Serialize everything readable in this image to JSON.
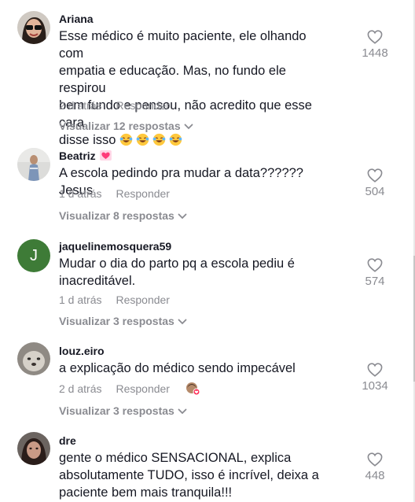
{
  "comments": [
    {
      "username": "Ariana",
      "text_lines": [
        "Esse médico é muito paciente, ele olhando com",
        "empatia e educação. Mas, no fundo ele respirou",
        "bem fundo e pensou, não acredito que esse cara",
        "disse isso"
      ],
      "time": "2 d atrás",
      "reply_label": "Responder",
      "view_replies": "Visualizar 12 respostas",
      "likes": "1448"
    },
    {
      "username": "Beatriz",
      "text_lines": [
        "A escola pedindo pra mudar a data?????? Jesus"
      ],
      "time": "1 d atrás",
      "reply_label": "Responder",
      "view_replies": "Visualizar 8 respostas",
      "likes": "504"
    },
    {
      "username": "jaquelinemosquera59",
      "avatar_letter": "J",
      "text_lines": [
        "Mudar o dia do parto pq a escola pediu é",
        "inacreditável."
      ],
      "time": "1 d atrás",
      "reply_label": "Responder",
      "view_replies": "Visualizar 3 respostas",
      "likes": "574"
    },
    {
      "username": "louz.eiro",
      "text_lines": [
        "a explicação do médico sendo impecável"
      ],
      "time": "2 d atrás",
      "reply_label": "Responder",
      "view_replies": "Visualizar 3 respostas",
      "likes": "1034"
    },
    {
      "username": "dre",
      "text_lines": [
        "gente o médico SENSACIONAL, explica",
        "absolutamente TUDO, isso é incrível, deixa a",
        "paciente bem mais tranquila!!!"
      ],
      "likes": "448"
    }
  ],
  "icons": {
    "like": "heart-outline-icon",
    "expand": "chevron-down-icon",
    "emoji": "laughing-crying-emoji",
    "badge": "pink-heart-emoji"
  },
  "colors": {
    "text": "#161823",
    "muted": "#8a8b91",
    "avatar_green": "#3e7b37"
  }
}
